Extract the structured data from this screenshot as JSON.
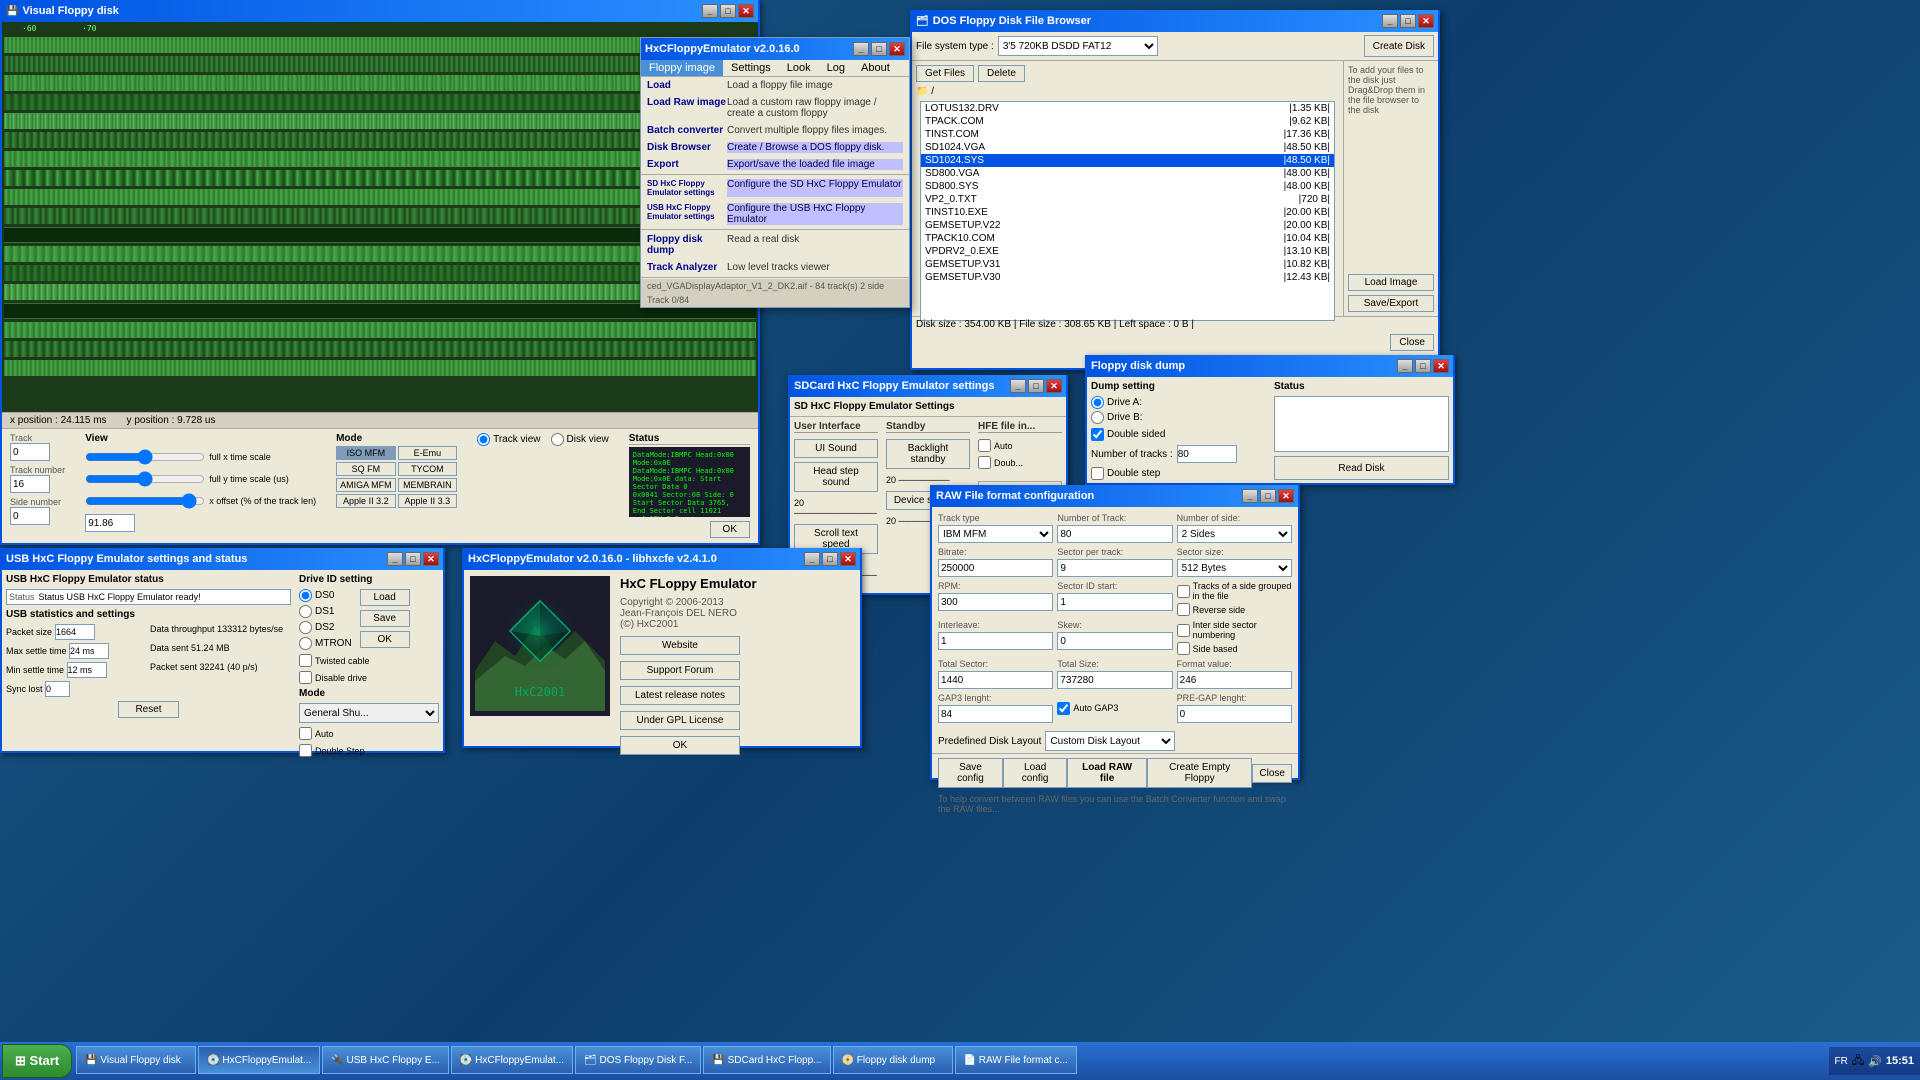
{
  "desktop": {
    "bg_color": "#1a5c8a"
  },
  "taskbar": {
    "time": "15:51",
    "items": [
      {
        "id": "visual-floppy-task",
        "label": "Visual Floppy disk"
      },
      {
        "id": "hxcfe-task",
        "label": "HxCFloppyEmulat..."
      },
      {
        "id": "usb-hxc-task",
        "label": "USB HxC Floppy E..."
      },
      {
        "id": "hxcfe2-task",
        "label": "HxCFloppyEmulat..."
      },
      {
        "id": "dos-floppy-task",
        "label": "DOS Floppy Disk F..."
      },
      {
        "id": "sdcard-task",
        "label": "SDCard HxC Flopp..."
      },
      {
        "id": "floppy-dump-task",
        "label": "Floppy disk dump"
      },
      {
        "id": "raw-task",
        "label": "RAW File format c..."
      }
    ]
  },
  "visual_floppy": {
    "title": "Visual Floppy disk",
    "track_label": "Track",
    "track_val": "0",
    "side_label": "Side number",
    "side_val": "0",
    "view_label": "View",
    "full_x_label": "full x time scale",
    "full_y_label": "full y time scale (us)",
    "x_offset_label": "x offset (% of the track len)",
    "x_offset_val": "91.86",
    "mode_title": "Mode",
    "modes": [
      "ISO MFM",
      "E-Emu",
      "SQ FM",
      "TYCOM",
      "AMIGA MFM",
      "MEMBRAIN"
    ],
    "apple_ver": "Apple II 3.2",
    "apple_ver2": "Apple II 3.3",
    "view_options": [
      "Track view",
      "Disk view"
    ],
    "status_title": "Status",
    "x_pos": "x position : 24.115 ms",
    "y_pos": "y position : 9.728 us",
    "track_num_label": "Track number",
    "track_num_val": "16"
  },
  "hxc_main": {
    "title": "HxCFloppyEmulator v2.0.16.0",
    "menu": [
      "Floppy image",
      "Settings",
      "Look",
      "Log",
      "About"
    ],
    "items": [
      {
        "btn": "Load",
        "desc": "Load a floppy file image"
      },
      {
        "btn": "Load Raw image",
        "desc": "Load a custom raw floppy image / create a custom floppy"
      },
      {
        "btn": "Batch converter",
        "desc": "Convert multiple floppy files images."
      },
      {
        "btn": "Disk Browser",
        "desc": "Create / Browse a DOS floppy disk."
      },
      {
        "btn": "Export",
        "desc": "Export/save the loaded file image"
      },
      {
        "btn": "SD HxC Floppy Emulator settings",
        "desc": "Configure the SD HxC Floppy Emulator"
      },
      {
        "btn": "USB HxC Floppy Emulator settings",
        "desc": "Configure the USB HxC Floppy Emulator"
      },
      {
        "btn": "Floppy disk dump",
        "desc": "Read a real disk"
      },
      {
        "btn": "Track Analyzer",
        "desc": "Low level tracks viewer"
      }
    ],
    "status_bar": "ced_VGADisplayAdaptor_V1_2_DK2.aif - 84 track(s) 2 side",
    "track_info": "Track 0/84"
  },
  "dos_browser": {
    "title": "DOS Floppy Disk File Browser",
    "fs_type_label": "File system type :",
    "fs_type_val": "3'5  720KB DSDD FAT12",
    "create_btn": "Create Disk",
    "get_files_btn": "Get Files",
    "delete_btn": "Delete",
    "root_dir": "/",
    "files": [
      {
        "name": "LOTUS132.DRV",
        "size": "|1.35 KB|"
      },
      {
        "name": "TPACK.COM",
        "size": "|9.62 KB|"
      },
      {
        "name": "TINST.COM",
        "size": "|17.36 KB|"
      },
      {
        "name": "SD1024.VGA",
        "size": "|48.50 KB|"
      },
      {
        "name": "SD1024.SYS",
        "size": "|48.50 KB|",
        "selected": true
      },
      {
        "name": "SD800.VGA",
        "size": "|48.00 KB|"
      },
      {
        "name": "SD800.SYS",
        "size": "|48.00 KB|"
      },
      {
        "name": "VP2_0.TXT",
        "size": "|720 B|"
      },
      {
        "name": "TINST10.EXE",
        "size": "|20.00 KB|"
      },
      {
        "name": "GEMSETUP.V22",
        "size": "|20.00 KB|"
      },
      {
        "name": "TPACK10.COM",
        "size": "|10.04 KB|"
      },
      {
        "name": "VPDRV2_0.EXE",
        "size": "|13.10 KB|"
      },
      {
        "name": "GEMSETUP.V31",
        "size": "|10.82 KB|"
      },
      {
        "name": "GEMSETUP.V30",
        "size": "|12.43 KB|"
      }
    ],
    "load_image_btn": "Load Image",
    "save_export_btn": "Save/Export",
    "close_btn": "Close",
    "disk_size_label": "Disk size : 354.00 KB | File size : 308.65 KB | Left space : 0 B |",
    "right_help": "To add your files to the disk just Drag&Drop them in the file browser to the disk"
  },
  "sdcard_window": {
    "title": "SDCard HxC Floppy Emulator settings",
    "subtitle": "SD HxC Floppy Emulator Settings",
    "ui_sound_btn": "UI Sound",
    "head_step_btn": "Head step sound",
    "scroll_text_btn": "Scroll text speed",
    "standby_title": "Standby",
    "backlight_standby_btn": "Backlight standby",
    "device_standby_btn": "Device standby",
    "hfe_file_label": "HFE file in...",
    "ok_btn": "OK",
    "slider1_val": "20",
    "slider2_val": "20"
  },
  "floppy_dump": {
    "title": "Floppy disk dump",
    "dump_setting_title": "Dump setting",
    "drive_a": "Drive A:",
    "drive_b": "Drive B:",
    "double_sided": "Double sided",
    "tracks_label": "Number of tracks :",
    "tracks_val": "80",
    "double_step": "Double step",
    "read_disk_btn": "Read Disk",
    "status_title": "Status"
  },
  "raw_config": {
    "title": "RAW File format configuration",
    "track_type_label": "Track type",
    "track_type_val": "IBM MFM",
    "num_tracks_label": "Number of Track:",
    "num_tracks_val": "80",
    "num_side_label": "Number of side:",
    "num_side_val": "2 Sides",
    "bitrate_label": "Bitrate:",
    "bitrate_val": "250000",
    "sector_per_track_label": "Sector per track:",
    "sector_per_track_val": "9",
    "sector_size_label": "Sector size:",
    "sector_size_val": "512 Bytes",
    "rpm_label": "RPM:",
    "rpm_val": "300",
    "sector_id_label": "Sector ID start:",
    "sector_id_val": "1",
    "interleave_label": "Interleave:",
    "interleave_val": "1",
    "skew_label": "Skew:",
    "skew_val": "0",
    "total_sector_label": "Total Sector:",
    "total_sector_val": "1440",
    "total_size_label": "Total Size:",
    "total_size_val": "737280",
    "format_val_label": "Format value:",
    "format_val": "246",
    "gap3_label": "GAP3 lenght:",
    "gap3_val": "84",
    "auto_gap3": "Auto GAP3",
    "pre_gap_label": "PRE-GAP lenght:",
    "pre_gap_val": "0",
    "side_grouped": "Tracks of a side grouped in the file",
    "reverse_side": "Reverse side",
    "inter_sector": "Inter side sector numbering",
    "side_based": "Side based",
    "predefined_label": "Predefined Disk Layout",
    "predefined_val": "Custom Disk Layout",
    "save_config_btn": "Save config",
    "load_config_btn": "Load config",
    "load_raw_btn": "Load RAW file",
    "create_empty_btn": "Create Empty Floppy",
    "close_btn": "Close",
    "note": "To help convert between RAW files you can use the Batch Converter function and swap the RAW files..."
  },
  "usb_window": {
    "title": "USB HxC Floppy Emulator settings and status",
    "status_title": "USB HxC Floppy Emulator status",
    "status_val": "Status USB HxC Floppy Emulator ready!",
    "stats_title": "USB statistics and settings",
    "packet_size_label": "Packet size",
    "packet_size_val": "1664",
    "throughput_label": "Data throughput",
    "throughput_val": "133312 bytes/se",
    "max_settle_label": "Max settle time",
    "max_settle_val": "24 ms",
    "data_sent_label": "Data sent",
    "data_sent_val": "51.24 MB",
    "min_settle_label": "Min settle time",
    "min_settle_val": "12 ms",
    "packet_sent_label": "Packet sent",
    "packet_sent_val": "32241 (40 p/s)",
    "sync_lost_label": "Sync lost",
    "sync_lost_val": "0",
    "reset_btn": "Reset",
    "drive_id_title": "Drive ID setting",
    "drives": [
      "DS0",
      "DS1",
      "DS2",
      "MTRON"
    ],
    "twisted_cable": "Twisted cable",
    "disable_drive": "Disable drive",
    "mode_title": "Mode",
    "auto_label": "Auto",
    "double_step": "Double Step",
    "load_btn": "Load",
    "save_btn": "Save",
    "ok_btn": "OK"
  },
  "hxc_about": {
    "title": "HxCFloppyEmulator v2.0.16.0 - libhxcfe v2.4.1.0",
    "app_name": "HxC FLoppy Emulator",
    "copyright": "Copyright © 2006-2013\nJean-François DEL NERO\n(©) HxC2001",
    "website_btn": "Website",
    "forum_btn": "Support Forum",
    "release_btn": "Latest release notes",
    "gpl_btn": "Under GPL License",
    "ok_btn": "OK"
  }
}
